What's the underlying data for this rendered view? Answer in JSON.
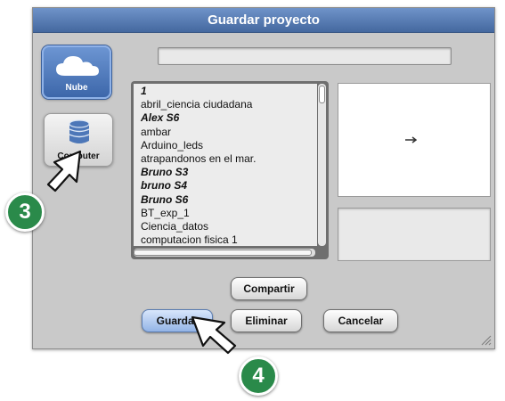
{
  "dialog": {
    "title": "Guardar proyecto"
  },
  "project_name": {
    "value": ""
  },
  "sources": [
    {
      "label": "Nube",
      "icon": "cloud-icon",
      "selected": true
    },
    {
      "label": "Computer",
      "icon": "database-icon",
      "selected": false
    }
  ],
  "projects": [
    {
      "name": "1",
      "shared": true
    },
    {
      "name": "abril_ciencia ciudadana",
      "shared": false
    },
    {
      "name": "Alex S6",
      "shared": true
    },
    {
      "name": "ambar",
      "shared": false
    },
    {
      "name": "Arduino_leds",
      "shared": false
    },
    {
      "name": "atrapandonos en el mar.",
      "shared": false
    },
    {
      "name": "Bruno S3",
      "shared": true
    },
    {
      "name": "bruno S4",
      "shared": true
    },
    {
      "name": "Bruno S6",
      "shared": true
    },
    {
      "name": "BT_exp_1",
      "shared": false
    },
    {
      "name": "Ciencia_datos",
      "shared": false
    },
    {
      "name": "computacion fisica 1",
      "shared": false
    }
  ],
  "buttons": {
    "share": "Compartir",
    "save": "Guardar",
    "delete": "Eliminar",
    "cancel": "Cancelar"
  },
  "callouts": {
    "step3": "3",
    "step4": "4"
  },
  "colors": {
    "titlebar": "#44689f",
    "callout": "#2a8a4a",
    "dialog_bg": "#c9c9c9"
  }
}
